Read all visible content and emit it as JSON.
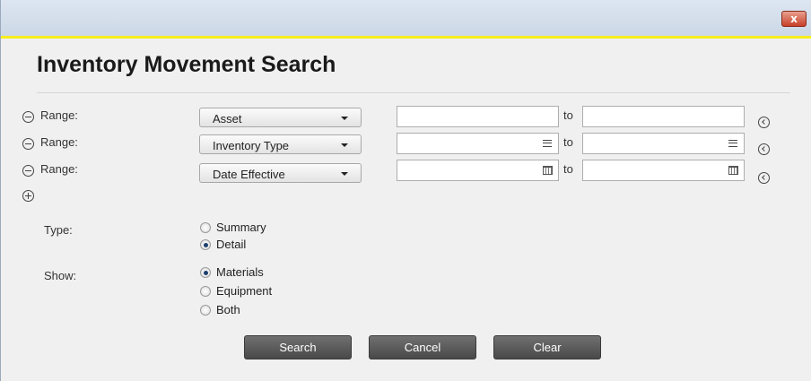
{
  "window": {
    "close_label": "x"
  },
  "title": "Inventory Movement Search",
  "ranges": [
    {
      "label": "Range:",
      "field": "Asset",
      "to": "to",
      "input_from_icon": "",
      "input_to_icon": ""
    },
    {
      "label": "Range:",
      "field": "Inventory Type",
      "to": "to",
      "input_from_icon": "menu-icon",
      "input_to_icon": "menu-icon"
    },
    {
      "label": "Range:",
      "field": "Date Effective",
      "to": "to",
      "input_from_icon": "calendar-icon",
      "input_to_icon": "calendar-icon"
    }
  ],
  "type": {
    "label": "Type:",
    "options": [
      {
        "label": "Summary",
        "checked": false
      },
      {
        "label": "Detail",
        "checked": true
      }
    ]
  },
  "show": {
    "label": "Show:",
    "options": [
      {
        "label": "Materials",
        "checked": true
      },
      {
        "label": "Equipment",
        "checked": false
      },
      {
        "label": "Both",
        "checked": false
      }
    ]
  },
  "buttons": {
    "search": "Search",
    "cancel": "Cancel",
    "clear": "Clear"
  },
  "colors": {
    "accent_line": "#f7ee1c",
    "button_bg": "#5a5a5a",
    "close_button": "#c8402a"
  }
}
